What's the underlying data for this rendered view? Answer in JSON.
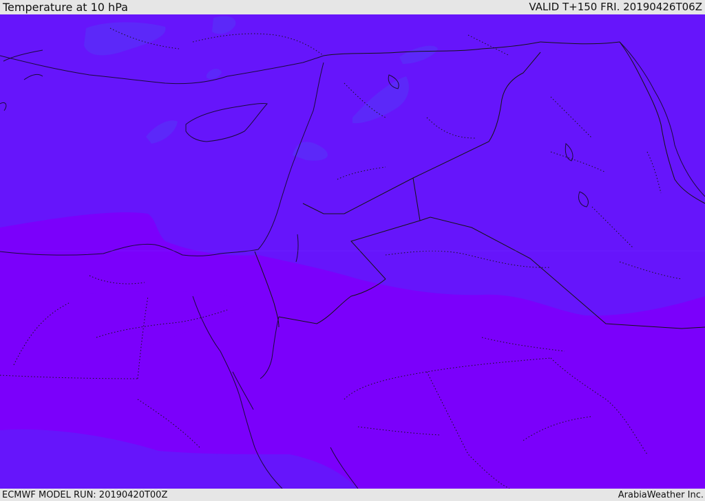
{
  "header": {
    "title": "Temperature at 10 hPa",
    "valid": "VALID T+150 FRI. 20190426T06Z"
  },
  "footer": {
    "model_run": "ECMWF MODEL RUN: 20190420T00Z",
    "credit": "ArabiaWeather Inc."
  },
  "map": {
    "region": "Eastern Mediterranean / Middle East",
    "colors": {
      "warm": "#7b00fb",
      "mid": "#6615fb",
      "cool": "#5a2cf8",
      "coast": "#1a0a3a",
      "border": "#141414"
    }
  }
}
